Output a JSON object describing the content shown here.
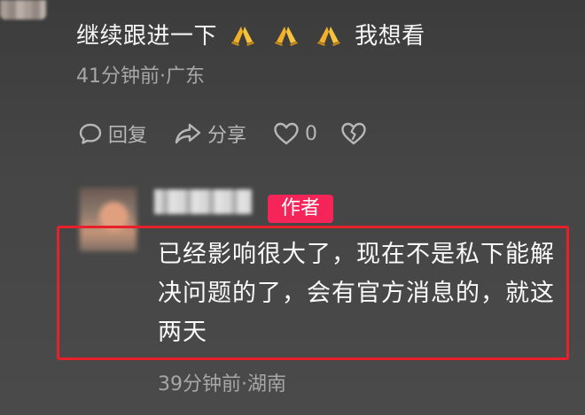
{
  "comment1": {
    "text": "继续跟进一下",
    "emojis": [
      "pray-emoji",
      "pray-emoji",
      "pray-emoji"
    ],
    "text_after": "我想看",
    "meta": "41分钟前·广东"
  },
  "actions": {
    "reply_label": "回复",
    "share_label": "分享",
    "like_count": "0"
  },
  "reply": {
    "badge": "作者",
    "text": "已经影响很大了，现在不是私下能解决问题的了，会有官方消息的，就这两天",
    "meta": "39分钟前·湖南"
  },
  "colors": {
    "badge": "#f5255a",
    "highlight_border": "#e8202a",
    "emoji": "#f2b02a"
  }
}
